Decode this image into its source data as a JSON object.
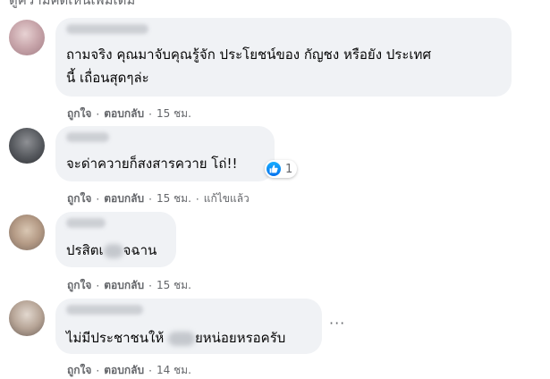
{
  "top_partial_text": "ดูความคิดเห็นเพิ่มเติม",
  "comments": [
    {
      "text_lines": [
        "ถามจริง คุณมาจับคุณรู้จัก ประโยชน์ของ กัญชง หรือยัง ประเทศ",
        "นี้ เถื่อนสุดๆล่ะ"
      ],
      "like_label": "ถูกใจ",
      "reply_label": "ตอบกลับ",
      "time": "15 ชม."
    },
    {
      "text_lines": [
        "จะด่าควายก็สงสารควาย โถ่!!"
      ],
      "reaction_count": "1",
      "like_label": "ถูกใจ",
      "reply_label": "ตอบกลับ",
      "time": "15 ชม.",
      "edited": "แก้ไขแล้ว"
    },
    {
      "text_before": "ปรสิตเ",
      "text_after": "จฉาน",
      "like_label": "ถูกใจ",
      "reply_label": "ตอบกลับ",
      "time": "15 ชม."
    },
    {
      "text_before": "ไม่มีประชาชนให้ ",
      "text_after": "ยหน่อยหรอครับ",
      "like_label": "ถูกใจ",
      "reply_label": "ตอบกลับ",
      "time": "14 ชม."
    }
  ],
  "colors": {
    "bubble": "#f0f2f5",
    "meta_text": "#65676b",
    "like_blue": "#1877f2"
  },
  "icons": {
    "reaction": "like-icon",
    "more": "more-options-icon"
  }
}
